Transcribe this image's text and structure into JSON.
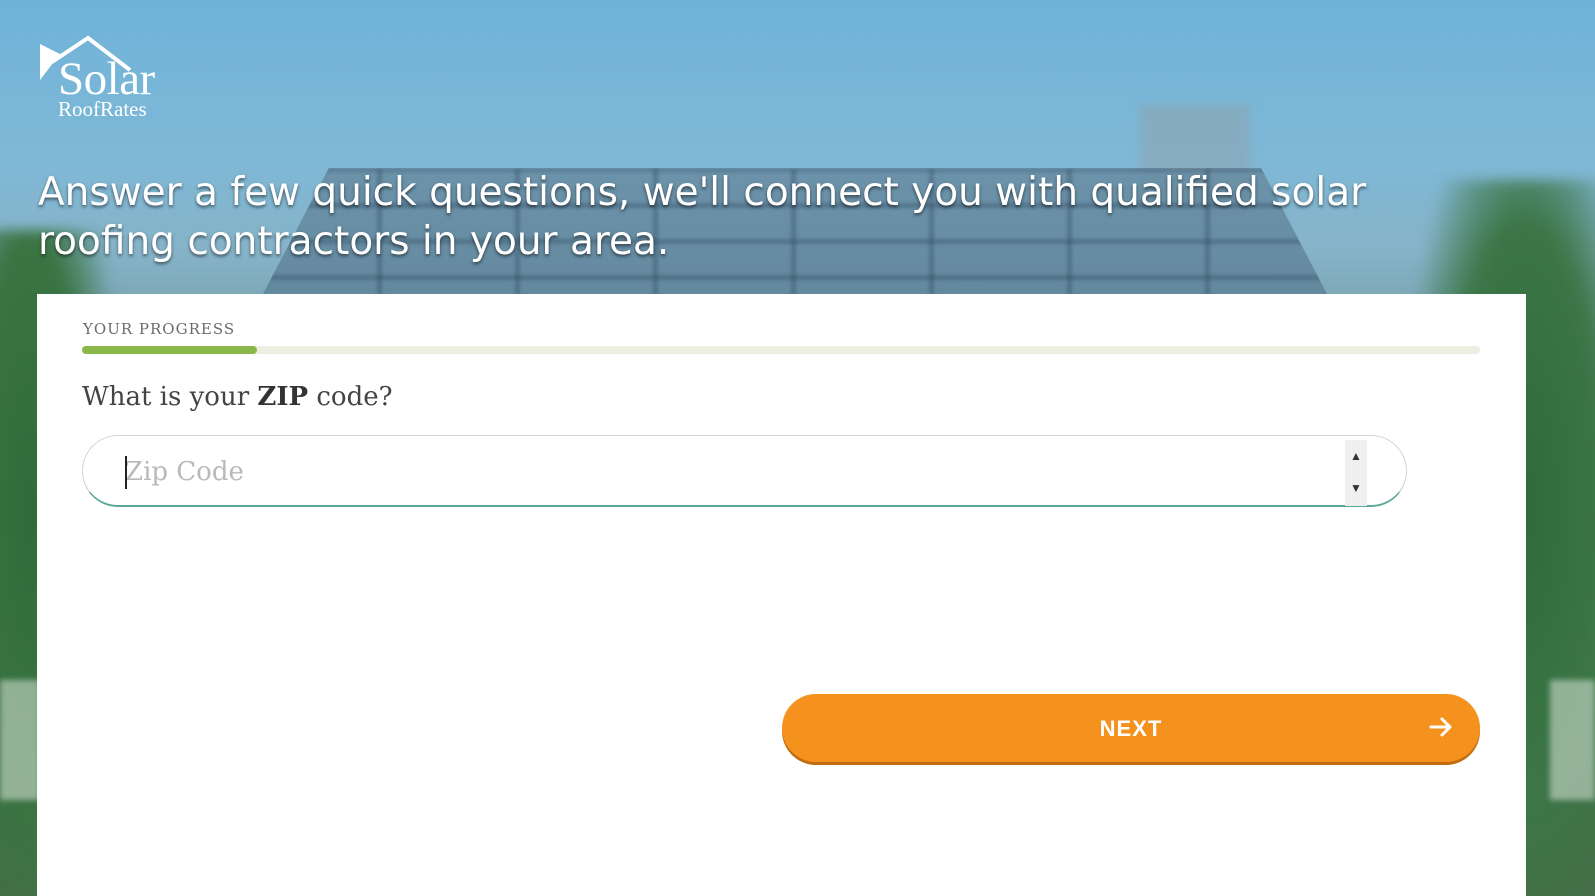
{
  "brand": {
    "name_main": "Solar",
    "name_sub": "RoofRates"
  },
  "headline": "Answer a few quick questions, we'll connect you with qualified solar roofing contractors in your area.",
  "progress": {
    "label": "YOUR PROGRESS",
    "fraction": 0.125
  },
  "question": {
    "prefix": "What is your ",
    "emphasis": "ZIP",
    "suffix": " code?"
  },
  "zip_field": {
    "value": "",
    "placeholder": "Zip Code"
  },
  "next_button": {
    "label": "NEXT",
    "icon": "arrow-right-icon"
  },
  "colors": {
    "accent": "#f5921e",
    "progress_fill": "#8bb84a",
    "input_border": "#5aa89a"
  }
}
